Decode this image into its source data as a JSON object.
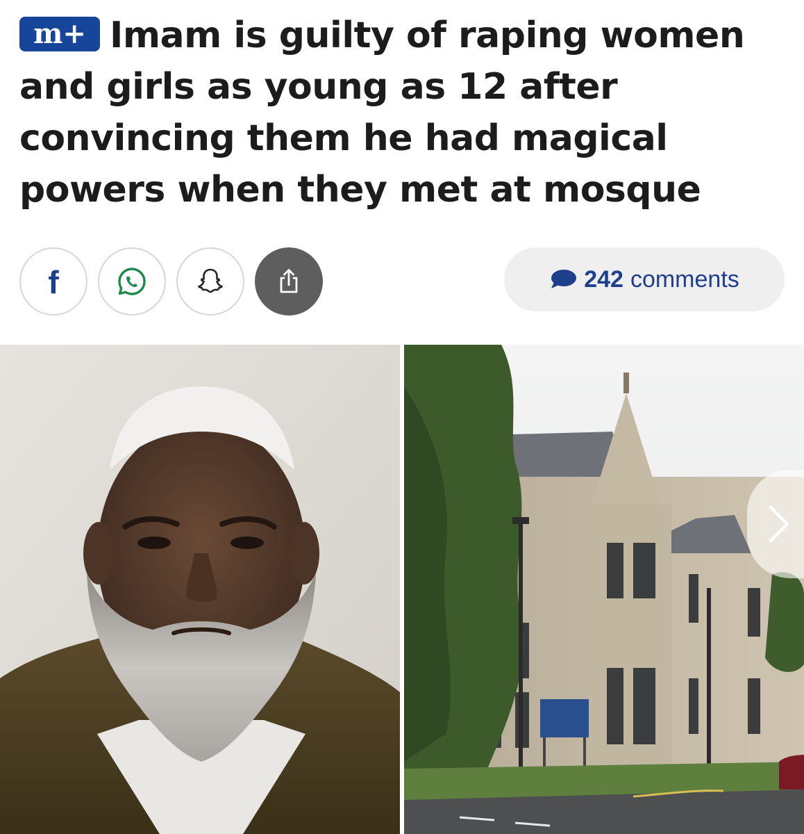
{
  "article": {
    "badge": "m+",
    "headline": "Imam is guilty of raping women and girls as young as 12 after convincing them he had magical powers when they met at mosque"
  },
  "share": {
    "buttons": [
      {
        "name": "facebook",
        "icon": "facebook-icon",
        "glyph": "f"
      },
      {
        "name": "whatsapp",
        "icon": "whatsapp-icon"
      },
      {
        "name": "snapchat",
        "icon": "snapchat-icon"
      },
      {
        "name": "share",
        "icon": "share-icon"
      }
    ]
  },
  "comments": {
    "count": "242",
    "label": "comments",
    "icon": "speech-bubble-icon"
  },
  "gallery": {
    "next_icon": "chevron-right-icon",
    "images": [
      {
        "name": "mugshot-photo",
        "icon": "person-photo"
      },
      {
        "name": "court-building-photo",
        "icon": "building-photo"
      }
    ]
  },
  "colors": {
    "brand_blue": "#1d3f8c",
    "badge_blue": "#16459a",
    "share_dark": "#5e5e5e",
    "headline_text": "#1c1c1c",
    "pill_bg": "#efefef"
  }
}
